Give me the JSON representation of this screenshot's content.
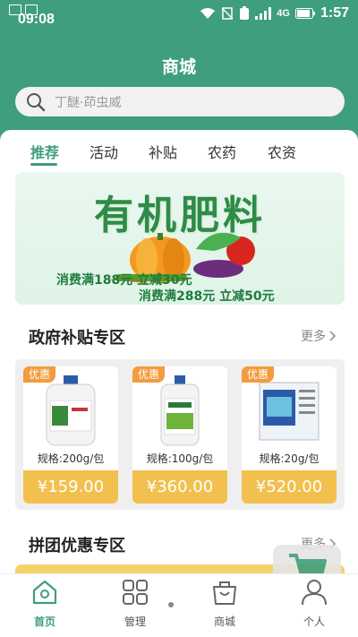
{
  "status_bar": {
    "time": "09:08",
    "network": "4G",
    "clock": "1:57",
    "battery_indicator": "$"
  },
  "header": {
    "title": "商城"
  },
  "search": {
    "placeholder": "丁醚·茚虫威"
  },
  "tabs": [
    {
      "label": "推荐",
      "active": true
    },
    {
      "label": "活动",
      "active": false
    },
    {
      "label": "补贴",
      "active": false
    },
    {
      "label": "农药",
      "active": false
    },
    {
      "label": "农资",
      "active": false
    }
  ],
  "banner": {
    "title": "有机肥料",
    "line1": "消费满188元 立减30元",
    "line2": "消费满288元 立减50元"
  },
  "subsidy_section": {
    "title": "政府补贴专区",
    "more": "更多",
    "products": [
      {
        "tag": "优惠",
        "spec": "规格:200g/包",
        "price": "¥159.00"
      },
      {
        "tag": "优惠",
        "spec": "规格:100g/包",
        "price": "¥360.00"
      },
      {
        "tag": "优惠",
        "spec": "规格:20g/包",
        "price": "¥520.00"
      }
    ]
  },
  "group_section": {
    "title": "拼团优惠专区",
    "more": "更多"
  },
  "bottom_nav": [
    {
      "label": "首页",
      "icon": "home-icon",
      "active": true
    },
    {
      "label": "管理",
      "icon": "grid-icon",
      "active": false
    },
    {
      "label": "商城",
      "icon": "bag-icon",
      "active": false
    },
    {
      "label": "个人",
      "icon": "person-icon",
      "active": false
    }
  ],
  "colors": {
    "primary": "#3f9e7c",
    "price_bg": "#f2c04e",
    "tag_bg": "#f39b3d"
  }
}
